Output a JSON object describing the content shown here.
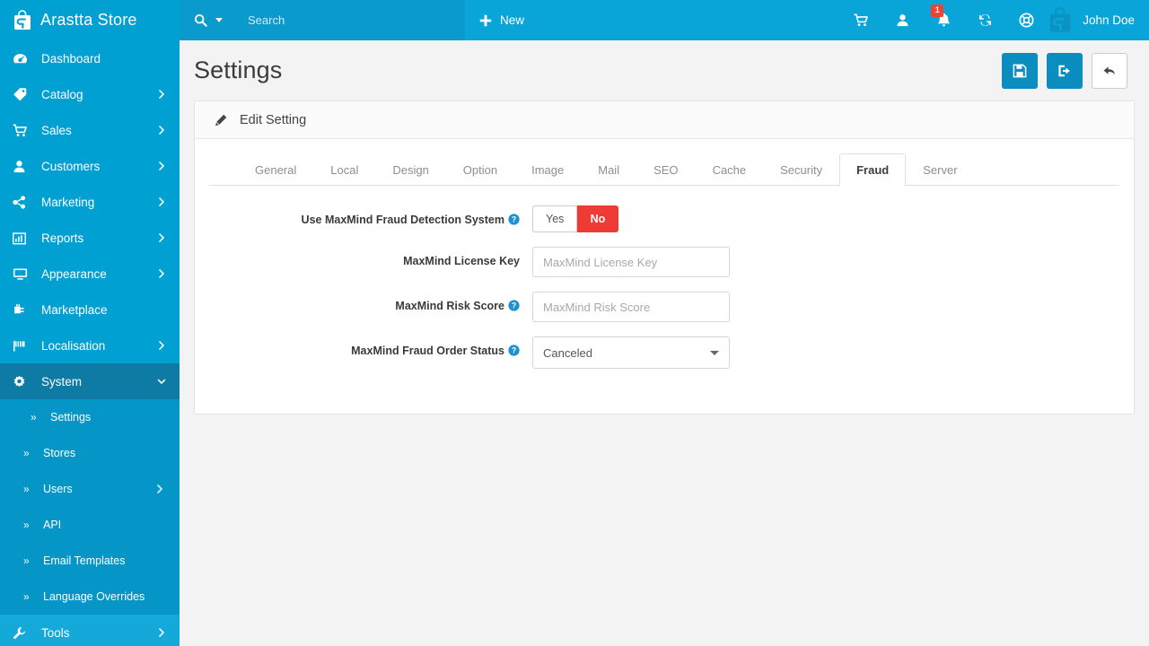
{
  "brand": {
    "name": "Arastta Store",
    "logo_icon": "arastta-bag-logo"
  },
  "sidebar": {
    "items": [
      {
        "label": "Dashboard",
        "icon": "dashboard-gauge-icon",
        "caret": ""
      },
      {
        "label": "Catalog",
        "icon": "tag-icon",
        "caret": "›"
      },
      {
        "label": "Sales",
        "icon": "shopping-cart-icon",
        "caret": "›"
      },
      {
        "label": "Customers",
        "icon": "user-icon",
        "caret": "›"
      },
      {
        "label": "Marketing",
        "icon": "share-nodes-icon",
        "caret": "›"
      },
      {
        "label": "Reports",
        "icon": "bar-chart-icon",
        "caret": "›"
      },
      {
        "label": "Appearance",
        "icon": "desktop-monitor-icon",
        "caret": "›"
      },
      {
        "label": "Marketplace",
        "icon": "plug-icon",
        "caret": ""
      },
      {
        "label": "Localisation",
        "icon": "flag-icon",
        "caret": "›"
      },
      {
        "label": "System",
        "icon": "gear-icon",
        "caret": "⌄"
      }
    ],
    "system_submenu": [
      {
        "label": "Settings",
        "chevron": "»",
        "active": true,
        "caret": ""
      },
      {
        "label": "Stores",
        "chevron": "»",
        "active": false,
        "caret": ""
      },
      {
        "label": "Users",
        "chevron": "»",
        "active": false,
        "caret": "›"
      },
      {
        "label": "API",
        "chevron": "»",
        "active": false,
        "caret": ""
      },
      {
        "label": "Email Templates",
        "chevron": "»",
        "active": false,
        "caret": ""
      },
      {
        "label": "Language Overrides",
        "chevron": "»",
        "active": false,
        "caret": ""
      }
    ],
    "tools": {
      "label": "Tools",
      "icon": "wrench-icon",
      "caret": "›"
    }
  },
  "topbar": {
    "search_placeholder": "Search",
    "search_value": "",
    "search_icon": "search-icon",
    "new_label": "New",
    "new_icon": "plus-icon",
    "icons": [
      {
        "name": "shopping-cart-icon",
        "badge": ""
      },
      {
        "name": "user-icon",
        "badge": ""
      },
      {
        "name": "bell-icon",
        "badge": "1"
      },
      {
        "name": "sync-refresh-icon",
        "badge": ""
      },
      {
        "name": "life-ring-help-icon",
        "badge": ""
      }
    ],
    "user_name": "John Doe",
    "badge_color": "#ef4136"
  },
  "page": {
    "title": "Settings",
    "actions": [
      {
        "name": "save-button",
        "icon": "floppy-save-icon",
        "style": "primary"
      },
      {
        "name": "save-and-exit-button",
        "icon": "sign-out-icon",
        "style": "primary"
      },
      {
        "name": "back-button",
        "icon": "back-arrow-icon",
        "style": "light"
      }
    ]
  },
  "panel": {
    "title": "Edit Setting",
    "icon": "pencil-icon"
  },
  "tabs": [
    {
      "label": "General",
      "active": false
    },
    {
      "label": "Local",
      "active": false
    },
    {
      "label": "Design",
      "active": false
    },
    {
      "label": "Option",
      "active": false
    },
    {
      "label": "Image",
      "active": false
    },
    {
      "label": "Mail",
      "active": false
    },
    {
      "label": "SEO",
      "active": false
    },
    {
      "label": "Cache",
      "active": false
    },
    {
      "label": "Security",
      "active": false
    },
    {
      "label": "Fraud",
      "active": true
    },
    {
      "label": "Server",
      "active": false
    }
  ],
  "form": {
    "use_maxmind": {
      "label": "Use MaxMind Fraud Detection System",
      "has_help": true,
      "options": [
        {
          "label": "Yes",
          "selected": false
        },
        {
          "label": "No",
          "selected": true
        }
      ],
      "selected_color": "#ef3b36"
    },
    "license_key": {
      "label": "MaxMind License Key",
      "has_help": false,
      "value": "",
      "placeholder": "MaxMind License Key"
    },
    "risk_score": {
      "label": "MaxMind Risk Score",
      "has_help": true,
      "value": "",
      "placeholder": "MaxMind Risk Score"
    },
    "fraud_order_status": {
      "label": "MaxMind Fraud Order Status",
      "has_help": true,
      "selected": "Canceled"
    }
  },
  "colors": {
    "sidebar": "#00a0d2",
    "sidebar_open": "#0e7ba5",
    "submenu": "#0596c7",
    "topbar": "#0aa5d8",
    "search_zone": "#0b9acc",
    "accent": "#0b8dc0",
    "danger": "#ef3b36",
    "page_bg": "#f3f3f4"
  }
}
